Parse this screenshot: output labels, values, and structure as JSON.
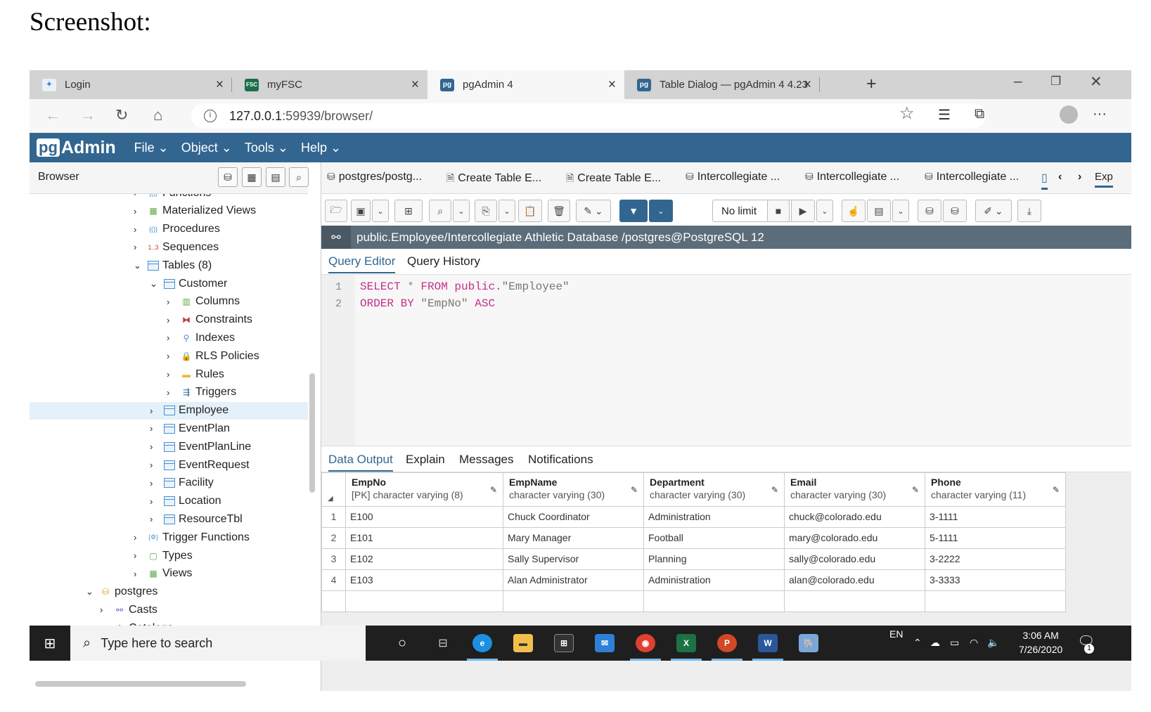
{
  "heading": "Screenshot:",
  "browser_tabs": [
    {
      "label": "Login",
      "active": false
    },
    {
      "label": "myFSC",
      "active": false
    },
    {
      "label": "pgAdmin 4",
      "active": true
    },
    {
      "label": "Table Dialog — pgAdmin 4 4.23",
      "active": false
    }
  ],
  "address": {
    "host": "127.0.0.1",
    "path": ":59939/browser/"
  },
  "pgadmin": {
    "logo": "Admin",
    "logo_pg": "pg",
    "menus": [
      "File ⌄",
      "Object ⌄",
      "Tools ⌄",
      "Help ⌄"
    ]
  },
  "browser_panel": {
    "title": "Browser",
    "tree": [
      {
        "label": "Functions",
        "level": 1,
        "chev": "›",
        "icon": "functions-icon"
      },
      {
        "label": "Materialized Views",
        "level": 1,
        "chev": "›",
        "icon": "materialized-views-icon"
      },
      {
        "label": "Procedures",
        "level": 1,
        "chev": "›",
        "icon": "procedures-icon"
      },
      {
        "label": "Sequences",
        "level": 1,
        "chev": "›",
        "icon": "sequences-icon"
      },
      {
        "label": "Tables (8)",
        "level": 1,
        "chev": "⌄",
        "icon": "tables-icon"
      },
      {
        "label": "Customer",
        "level": 2,
        "chev": "⌄",
        "icon": "table-icon"
      },
      {
        "label": "Columns",
        "level": 3,
        "chev": "›",
        "icon": "columns-icon"
      },
      {
        "label": "Constraints",
        "level": 3,
        "chev": "›",
        "icon": "constraints-icon"
      },
      {
        "label": "Indexes",
        "level": 3,
        "chev": "›",
        "icon": "indexes-icon"
      },
      {
        "label": "RLS Policies",
        "level": 3,
        "chev": "›",
        "icon": "rls-policies-icon"
      },
      {
        "label": "Rules",
        "level": 3,
        "chev": "›",
        "icon": "rules-icon"
      },
      {
        "label": "Triggers",
        "level": 3,
        "chev": "›",
        "icon": "triggers-icon"
      },
      {
        "label": "Employee",
        "level": 2,
        "chev": "›",
        "icon": "table-icon",
        "selected": true
      },
      {
        "label": "EventPlan",
        "level": 2,
        "chev": "›",
        "icon": "table-icon"
      },
      {
        "label": "EventPlanLine",
        "level": 2,
        "chev": "›",
        "icon": "table-icon"
      },
      {
        "label": "EventRequest",
        "level": 2,
        "chev": "›",
        "icon": "table-icon"
      },
      {
        "label": "Facility",
        "level": 2,
        "chev": "›",
        "icon": "table-icon"
      },
      {
        "label": "Location",
        "level": 2,
        "chev": "›",
        "icon": "table-icon"
      },
      {
        "label": "ResourceTbl",
        "level": 2,
        "chev": "›",
        "icon": "table-icon"
      },
      {
        "label": "Trigger Functions",
        "level": 1,
        "chev": "›",
        "icon": "trigger-functions-icon"
      },
      {
        "label": "Types",
        "level": 1,
        "chev": "›",
        "icon": "types-icon"
      },
      {
        "label": "Views",
        "level": 1,
        "chev": "›",
        "icon": "views-icon"
      },
      {
        "label": "postgres",
        "level": 0,
        "chev": "⌄",
        "icon": "database-icon"
      },
      {
        "label": "Casts",
        "level": 0.5,
        "chev": "›",
        "icon": "casts-icon"
      },
      {
        "label": "Catalogs",
        "level": 0.5,
        "chev": "›",
        "icon": "catalogs-icon"
      }
    ]
  },
  "panel_tabs": [
    "postgres/postg...",
    "Create Table E...",
    "Create Table E...",
    "Intercollegiate ...",
    "Intercollegiate ...",
    "Intercollegiate ...",
    "Exp"
  ],
  "toolbar": {
    "limit_select": "No limit"
  },
  "connection": "public.Employee/Intercollegiate Athletic Database /postgres@PostgreSQL 12",
  "query_tabs": [
    "Query Editor",
    "Query History"
  ],
  "editor": {
    "line_numbers": [
      "1",
      "2"
    ],
    "line1": {
      "kw1": "SELECT",
      "star": " * ",
      "kw2": "FROM",
      "schema": " public.",
      "str": "\"Employee\""
    },
    "line2": {
      "kw1": "ORDER BY",
      "str": " \"EmpNo\" ",
      "kw2": "ASC"
    }
  },
  "output_tabs": [
    "Data Output",
    "Explain",
    "Messages",
    "Notifications"
  ],
  "results": {
    "columns": [
      {
        "name": "EmpNo",
        "type": "[PK] character varying (8)"
      },
      {
        "name": "EmpName",
        "type": "character varying (30)"
      },
      {
        "name": "Department",
        "type": "character varying (30)"
      },
      {
        "name": "Email",
        "type": "character varying (30)"
      },
      {
        "name": "Phone",
        "type": "character varying (11)"
      }
    ],
    "rows": [
      {
        "n": "1",
        "cells": [
          "E100",
          "Chuck Coordinator",
          "Administration",
          "chuck@colorado.edu",
          "3-1111"
        ]
      },
      {
        "n": "2",
        "cells": [
          "E101",
          "Mary Manager",
          "Football",
          "mary@colorado.edu",
          "5-1111"
        ]
      },
      {
        "n": "3",
        "cells": [
          "E102",
          "Sally Supervisor",
          "Planning",
          "sally@colorado.edu",
          "3-2222"
        ]
      },
      {
        "n": "4",
        "cells": [
          "E103",
          "Alan Administrator",
          "Administration",
          "alan@colorado.edu",
          "3-3333"
        ]
      }
    ]
  },
  "taskbar": {
    "search_placeholder": "Type here to search",
    "lang": "EN",
    "time": "3:06 AM",
    "date": "7/26/2020",
    "notif_count": "1"
  },
  "colors": {
    "pgadmin_blue": "#326690",
    "selected_row": "#e4f1fb",
    "keyword": "#c42f8a"
  }
}
